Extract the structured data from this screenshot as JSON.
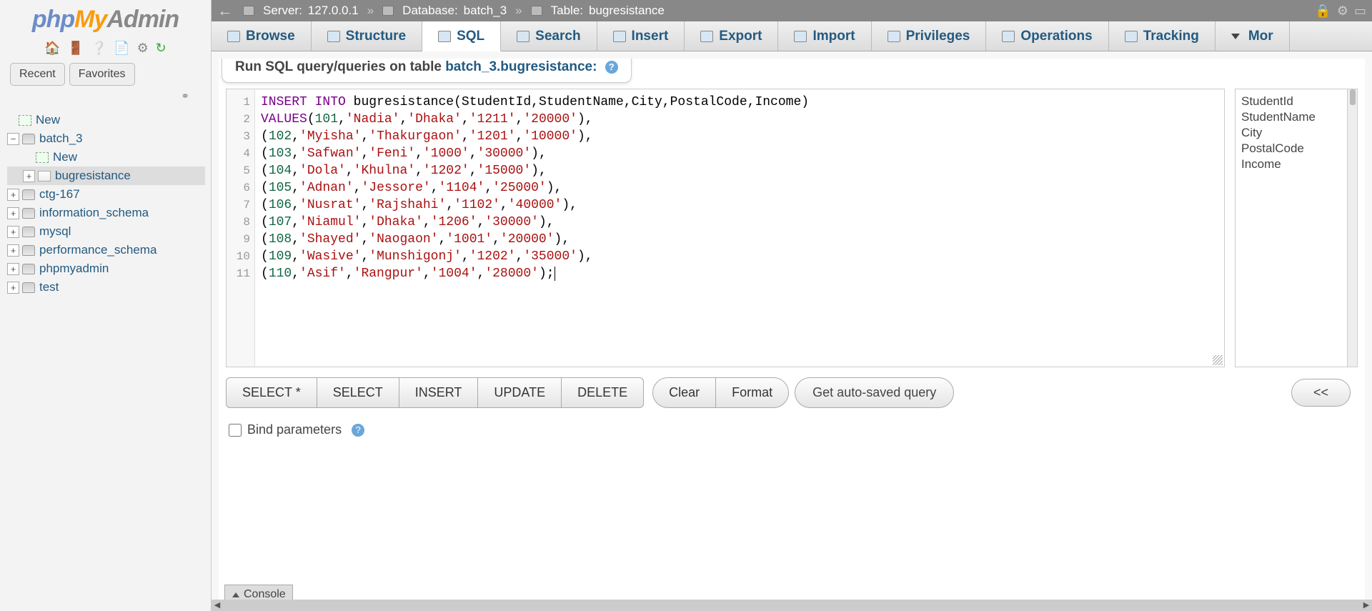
{
  "logo": {
    "php": "php",
    "my": "My",
    "admin": "Admin"
  },
  "sidebar_tabs": {
    "recent": "Recent",
    "favorites": "Favorites"
  },
  "tree": {
    "new_top": "New",
    "db_current": "batch_3",
    "new_table": "New",
    "table_current": "bugresistance",
    "dbs": [
      "ctg-167",
      "information_schema",
      "mysql",
      "performance_schema",
      "phpmyadmin",
      "test"
    ]
  },
  "breadcrumb": {
    "server_label": "Server:",
    "server_value": "127.0.0.1",
    "db_label": "Database:",
    "db_value": "batch_3",
    "table_label": "Table:",
    "table_value": "bugresistance"
  },
  "tabs": [
    "Browse",
    "Structure",
    "SQL",
    "Search",
    "Insert",
    "Export",
    "Import",
    "Privileges",
    "Operations",
    "Tracking",
    "Mor"
  ],
  "active_tab_index": 2,
  "header": {
    "prefix": "Run SQL query/queries on table ",
    "target": "batch_3.bugresistance:"
  },
  "sql_lines": [
    {
      "n": 1,
      "seg": [
        [
          "kw",
          "INSERT"
        ],
        [
          "pn",
          " "
        ],
        [
          "kw",
          "INTO"
        ],
        [
          "pn",
          " "
        ],
        [
          "fn",
          "bugresistance"
        ],
        [
          "pn",
          "("
        ],
        [
          "fn",
          "StudentId"
        ],
        [
          "pn",
          ","
        ],
        [
          "fn",
          "StudentName"
        ],
        [
          "pn",
          ","
        ],
        [
          "fn",
          "City"
        ],
        [
          "pn",
          ","
        ],
        [
          "fn",
          "PostalCode"
        ],
        [
          "pn",
          ","
        ],
        [
          "fn",
          "Income"
        ],
        [
          "pn",
          ")"
        ]
      ]
    },
    {
      "n": 2,
      "seg": [
        [
          "kw",
          "VALUES"
        ],
        [
          "pn",
          "("
        ],
        [
          "num",
          "101"
        ],
        [
          "pn",
          ","
        ],
        [
          "str",
          "'Nadia'"
        ],
        [
          "pn",
          ","
        ],
        [
          "str",
          "'Dhaka'"
        ],
        [
          "pn",
          ","
        ],
        [
          "str",
          "'1211'"
        ],
        [
          "pn",
          ","
        ],
        [
          "str",
          "'20000'"
        ],
        [
          "pn",
          "),"
        ]
      ]
    },
    {
      "n": 3,
      "seg": [
        [
          "pn",
          "("
        ],
        [
          "num",
          "102"
        ],
        [
          "pn",
          ","
        ],
        [
          "str",
          "'Myisha'"
        ],
        [
          "pn",
          ","
        ],
        [
          "str",
          "'Thakurgaon'"
        ],
        [
          "pn",
          ","
        ],
        [
          "str",
          "'1201'"
        ],
        [
          "pn",
          ","
        ],
        [
          "str",
          "'10000'"
        ],
        [
          "pn",
          "),"
        ]
      ]
    },
    {
      "n": 4,
      "seg": [
        [
          "pn",
          "("
        ],
        [
          "num",
          "103"
        ],
        [
          "pn",
          ","
        ],
        [
          "str",
          "'Safwan'"
        ],
        [
          "pn",
          ","
        ],
        [
          "str",
          "'Feni'"
        ],
        [
          "pn",
          ","
        ],
        [
          "str",
          "'1000'"
        ],
        [
          "pn",
          ","
        ],
        [
          "str",
          "'30000'"
        ],
        [
          "pn",
          "),"
        ]
      ]
    },
    {
      "n": 5,
      "seg": [
        [
          "pn",
          "("
        ],
        [
          "num",
          "104"
        ],
        [
          "pn",
          ","
        ],
        [
          "str",
          "'Dola'"
        ],
        [
          "pn",
          ","
        ],
        [
          "str",
          "'Khulna'"
        ],
        [
          "pn",
          ","
        ],
        [
          "str",
          "'1202'"
        ],
        [
          "pn",
          ","
        ],
        [
          "str",
          "'15000'"
        ],
        [
          "pn",
          "),"
        ]
      ]
    },
    {
      "n": 6,
      "seg": [
        [
          "pn",
          "("
        ],
        [
          "num",
          "105"
        ],
        [
          "pn",
          ","
        ],
        [
          "str",
          "'Adnan'"
        ],
        [
          "pn",
          ","
        ],
        [
          "str",
          "'Jessore'"
        ],
        [
          "pn",
          ","
        ],
        [
          "str",
          "'1104'"
        ],
        [
          "pn",
          ","
        ],
        [
          "str",
          "'25000'"
        ],
        [
          "pn",
          "),"
        ]
      ]
    },
    {
      "n": 7,
      "seg": [
        [
          "pn",
          "("
        ],
        [
          "num",
          "106"
        ],
        [
          "pn",
          ","
        ],
        [
          "str",
          "'Nusrat'"
        ],
        [
          "pn",
          ","
        ],
        [
          "str",
          "'Rajshahi'"
        ],
        [
          "pn",
          ","
        ],
        [
          "str",
          "'1102'"
        ],
        [
          "pn",
          ","
        ],
        [
          "str",
          "'40000'"
        ],
        [
          "pn",
          "),"
        ]
      ]
    },
    {
      "n": 8,
      "seg": [
        [
          "pn",
          "("
        ],
        [
          "num",
          "107"
        ],
        [
          "pn",
          ","
        ],
        [
          "str",
          "'Niamul'"
        ],
        [
          "pn",
          ","
        ],
        [
          "str",
          "'Dhaka'"
        ],
        [
          "pn",
          ","
        ],
        [
          "str",
          "'1206'"
        ],
        [
          "pn",
          ","
        ],
        [
          "str",
          "'30000'"
        ],
        [
          "pn",
          "),"
        ]
      ]
    },
    {
      "n": 9,
      "seg": [
        [
          "pn",
          "("
        ],
        [
          "num",
          "108"
        ],
        [
          "pn",
          ","
        ],
        [
          "str",
          "'Shayed'"
        ],
        [
          "pn",
          ","
        ],
        [
          "str",
          "'Naogaon'"
        ],
        [
          "pn",
          ","
        ],
        [
          "str",
          "'1001'"
        ],
        [
          "pn",
          ","
        ],
        [
          "str",
          "'20000'"
        ],
        [
          "pn",
          "),"
        ]
      ]
    },
    {
      "n": 10,
      "seg": [
        [
          "pn",
          "("
        ],
        [
          "num",
          "109"
        ],
        [
          "pn",
          ","
        ],
        [
          "str",
          "'Wasive'"
        ],
        [
          "pn",
          ","
        ],
        [
          "str",
          "'Munshigonj'"
        ],
        [
          "pn",
          ","
        ],
        [
          "str",
          "'1202'"
        ],
        [
          "pn",
          ","
        ],
        [
          "str",
          "'35000'"
        ],
        [
          "pn",
          "),"
        ]
      ]
    },
    {
      "n": 11,
      "seg": [
        [
          "pn",
          "("
        ],
        [
          "num",
          "110"
        ],
        [
          "pn",
          ","
        ],
        [
          "str",
          "'Asif'"
        ],
        [
          "pn",
          ","
        ],
        [
          "str",
          "'Rangpur'"
        ],
        [
          "pn",
          ","
        ],
        [
          "str",
          "'1004'"
        ],
        [
          "pn",
          ","
        ],
        [
          "str",
          "'28000'"
        ],
        [
          "pn",
          ");"
        ]
      ]
    }
  ],
  "columns_panel": [
    "StudentId",
    "StudentName",
    "City",
    "PostalCode",
    "Income"
  ],
  "buttons": {
    "select_star": "SELECT *",
    "select": "SELECT",
    "insert": "INSERT",
    "update": "UPDATE",
    "delete": "DELETE",
    "clear": "Clear",
    "format": "Format",
    "auto_saved": "Get auto-saved query",
    "columns_toggle": "<<"
  },
  "bind_params": "Bind parameters",
  "console": "Console"
}
